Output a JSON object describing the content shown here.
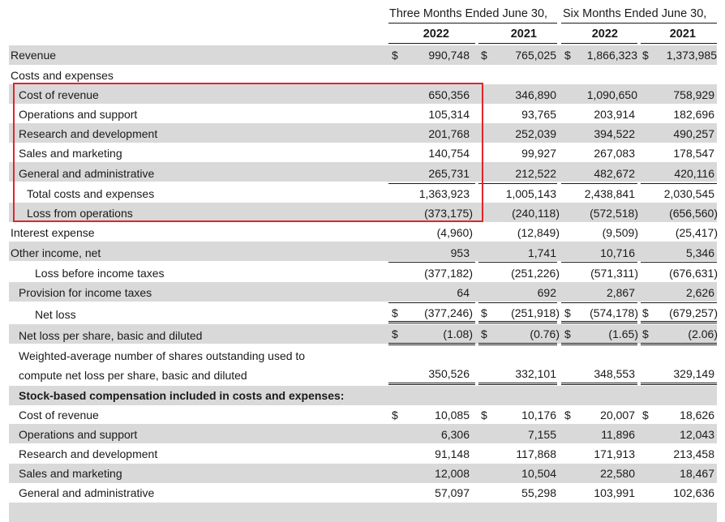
{
  "header": {
    "three_months": "Three Months Ended June 30,",
    "six_months": "Six Months Ended June 30,",
    "years": [
      "2022",
      "2021",
      "2022",
      "2021"
    ]
  },
  "highlight_color": "#e0262b",
  "rows": {
    "revenue": {
      "label": "Revenue",
      "v": [
        "990,748",
        "765,025",
        "1,866,323",
        "1,373,985"
      ]
    },
    "costs_header": {
      "label": "Costs and expenses"
    },
    "cost_of_revenue": {
      "label": "Cost of revenue",
      "v": [
        "650,356",
        "346,890",
        "1,090,650",
        "758,929"
      ]
    },
    "ops_support": {
      "label": "Operations and support",
      "v": [
        "105,314",
        "93,765",
        "203,914",
        "182,696"
      ]
    },
    "rnd": {
      "label": "Research and development",
      "v": [
        "201,768",
        "252,039",
        "394,522",
        "490,257"
      ]
    },
    "sales_mkt": {
      "label": "Sales and marketing",
      "v": [
        "140,754",
        "99,927",
        "267,083",
        "178,547"
      ]
    },
    "gna": {
      "label": "General and administrative",
      "v": [
        "265,731",
        "212,522",
        "482,672",
        "420,116"
      ]
    },
    "total_costs": {
      "label": "Total costs and expenses",
      "v": [
        "1,363,923",
        "1,005,143",
        "2,438,841",
        "2,030,545"
      ]
    },
    "loss_ops": {
      "label": "Loss from operations",
      "v": [
        "(373,175)",
        "(240,118)",
        "(572,518)",
        "(656,560)"
      ]
    },
    "interest": {
      "label": "Interest expense",
      "v": [
        "(4,960)",
        "(12,849)",
        "(9,509)",
        "(25,417)"
      ]
    },
    "other_income": {
      "label": "Other income, net",
      "v": [
        "953",
        "1,741",
        "10,716",
        "5,346"
      ]
    },
    "loss_before_tax": {
      "label": "Loss before income taxes",
      "v": [
        "(377,182)",
        "(251,226)",
        "(571,311)",
        "(676,631)"
      ]
    },
    "provision": {
      "label": "Provision for income taxes",
      "v": [
        "64",
        "692",
        "2,867",
        "2,626"
      ]
    },
    "net_loss": {
      "label": "Net loss",
      "v": [
        "(377,246)",
        "(251,918)",
        "(574,178)",
        "(679,257)"
      ]
    },
    "eps": {
      "label": "Net loss per share, basic and diluted",
      "v": [
        "(1.08)",
        "(0.76)",
        "(1.65)",
        "(2.06)"
      ]
    },
    "wavg_line1": {
      "label": "Weighted-average number of shares outstanding used to"
    },
    "wavg_line2": {
      "label": "compute net loss per share, basic and diluted",
      "v": [
        "350,526",
        "332,101",
        "348,553",
        "329,149"
      ]
    },
    "sbc_header": {
      "label": "Stock-based compensation included in costs and expenses:"
    },
    "sbc_cost_rev": {
      "label": "Cost of revenue",
      "v": [
        "10,085",
        "10,176",
        "20,007",
        "18,626"
      ]
    },
    "sbc_ops": {
      "label": "Operations and support",
      "v": [
        "6,306",
        "7,155",
        "11,896",
        "12,043"
      ]
    },
    "sbc_rnd": {
      "label": "Research and development",
      "v": [
        "91,148",
        "117,868",
        "171,913",
        "213,458"
      ]
    },
    "sbc_sales": {
      "label": "Sales and marketing",
      "v": [
        "12,008",
        "10,504",
        "22,580",
        "18,467"
      ]
    },
    "sbc_gna": {
      "label": "General and administrative",
      "v": [
        "57,097",
        "55,298",
        "103,991",
        "102,636"
      ]
    }
  },
  "currency_symbol": "$"
}
